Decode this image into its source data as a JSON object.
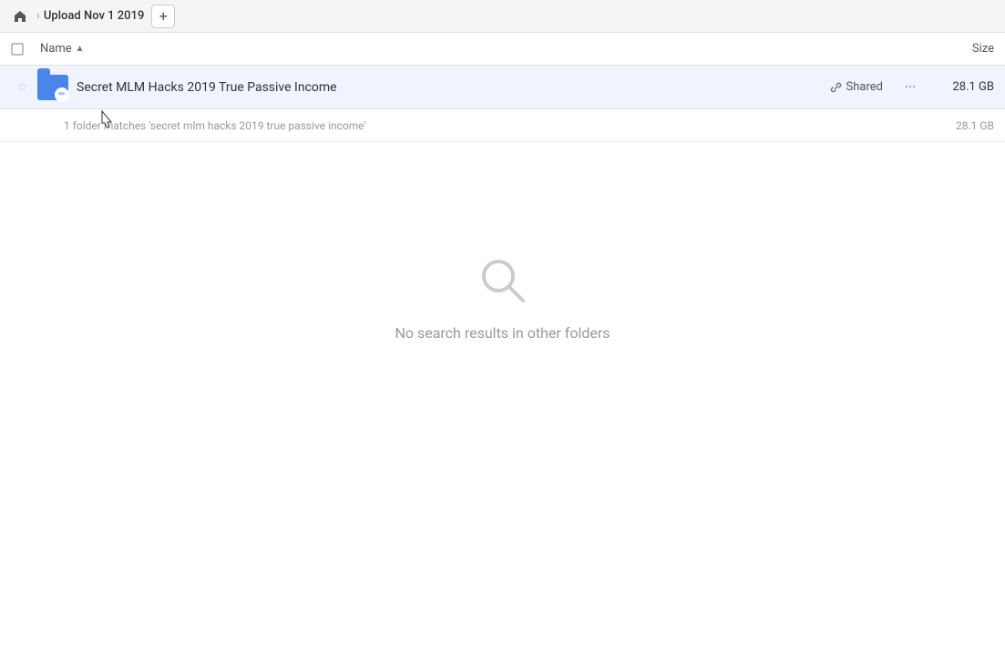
{
  "topbar": {
    "home_label": "home",
    "breadcrumb_text": "Upload Nov 1 2019",
    "add_btn_label": "+"
  },
  "columns": {
    "name_label": "Name",
    "sort_indicator": "▲",
    "size_label": "Size"
  },
  "file_row": {
    "name": "Secret MLM Hacks 2019 True Passive Income",
    "shared_label": "Shared",
    "size": "28.1 GB",
    "more_dots": "···"
  },
  "summary": {
    "text": "1 folder matches 'secret mlm hacks 2019 true passive income'",
    "size": "28.1 GB"
  },
  "empty_state": {
    "text": "No search results in other folders"
  },
  "icons": {
    "home": "⌂",
    "chevron_right": "›",
    "link": "🔗",
    "star": "☆",
    "pencil": "✏",
    "dots": "•••"
  }
}
